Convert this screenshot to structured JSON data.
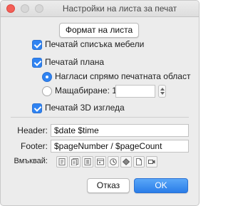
{
  "window": {
    "title": "Настройки на листа за печат"
  },
  "page_setup_button": "Формат на листа",
  "options": {
    "print_furniture_list": "Печатай списъка мебели",
    "print_plan": "Печатай плана",
    "fit_to_print_area": "Нагласи спрямо печатната област",
    "scale_label": "Мащабиране: 1 /",
    "scale_value": "",
    "print_3d_view": "Печатай 3D изгледа"
  },
  "header": {
    "label": "Header:",
    "value": "$date $time"
  },
  "footer": {
    "label": "Footer:",
    "value": "$pageNumber / $pageCount"
  },
  "insert": {
    "label": "Вмъквай:",
    "buttons": [
      "page-number-icon",
      "page-count-icon",
      "date-icon",
      "time-icon",
      "clock-icon",
      "house-icon",
      "file-name-icon",
      "camera-icon"
    ]
  },
  "buttons": {
    "cancel": "Отказ",
    "ok": "OK"
  },
  "colors": {
    "accent": "#2f83f2",
    "close": "#f35f57"
  }
}
